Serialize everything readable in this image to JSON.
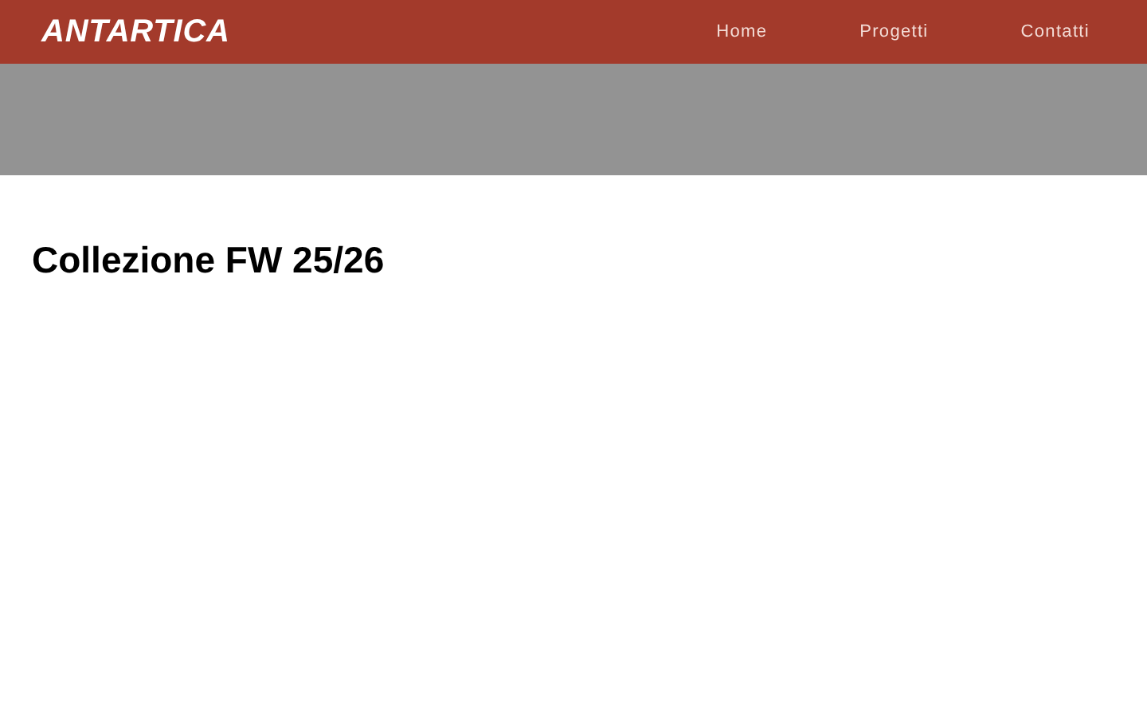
{
  "header": {
    "logo": "ANTARTICA",
    "nav": [
      {
        "label": "Home"
      },
      {
        "label": "Progetti"
      },
      {
        "label": "Contatti"
      }
    ]
  },
  "title": "Collezione FW 25/26"
}
